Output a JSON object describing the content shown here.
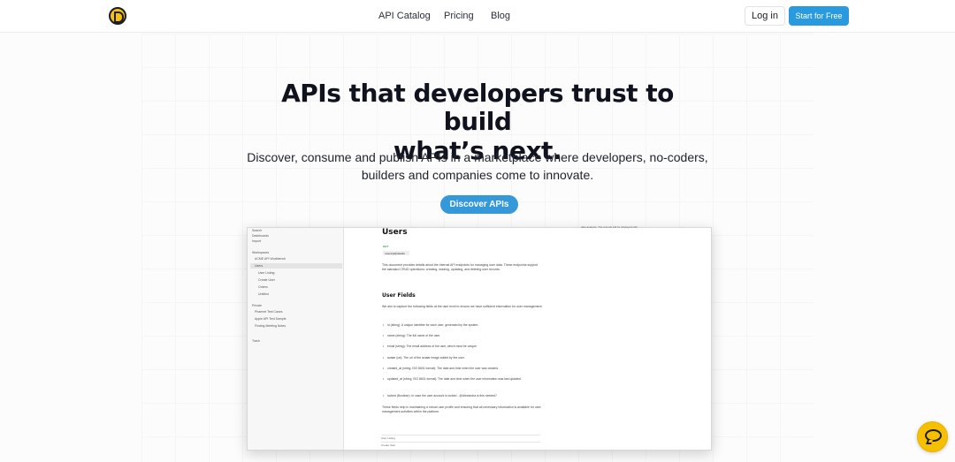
{
  "header": {
    "logo": "logo-icon",
    "nav": [
      "API Catalog",
      "Pricing",
      "Blog"
    ],
    "login_label": "Log in",
    "start_label": "Start for Free"
  },
  "hero": {
    "title_line1": "APIs that developers trust to build",
    "title_line2": "what’s next.",
    "subtitle_line1": "Discover, consume and publish APIs in a marketplace where developers, no-coders,",
    "subtitle_line2": "builders and companies come to innovate.",
    "cta": "Discover APIs"
  },
  "preview": {
    "sidebar": {
      "items": [
        "Search",
        "Dashboards",
        "Import",
        "Workspaces",
        "ACME API Workbench",
        "Users",
        "User Listing",
        "Create User",
        "Orders",
        "Untitled",
        "Private",
        "Pharmet Test Cases",
        "Apple API Test Sample",
        "Finding Meeting Notes",
        "Trash"
      ]
    },
    "doc": {
      "title": "Users",
      "method": "GET",
      "endpoint": "/users/{id}/details",
      "intro": "This document provides details about the internal API endpoints for managing user data. These endpoints support the standard CRUD operations: creating, reading, updating, and deleting user records.",
      "fields_heading": "User Fields",
      "fields_intro": "We aim to capture the following fields at the user level to ensure we have sufficient information for user management:",
      "fields": [
        "id (string): A unique identifier for each user, generated by the system.",
        "name (string): The full name of the user.",
        "email (string): The email address of the user, which must be unique.",
        "avatar (url): The url of the avatar image added by the user.",
        "created_at (string, ISO 8601 format): The date and time when the user was created.",
        "updated_at (string, ISO 8601 format): The date and time when the user information was last updated.",
        "locked (Boolean): In case the user account is locked - @Alexandra is this needed?"
      ],
      "closing": "These fields help in maintaining a robust user profile and ensuring that all necessary information is available for user management activities within the platform.",
      "rows": [
        "User Listing",
        "Create User"
      ]
    },
    "right_note": "data analysis. The records will be displayed with"
  },
  "chat": {
    "icon": "chat-bubble-icon"
  }
}
